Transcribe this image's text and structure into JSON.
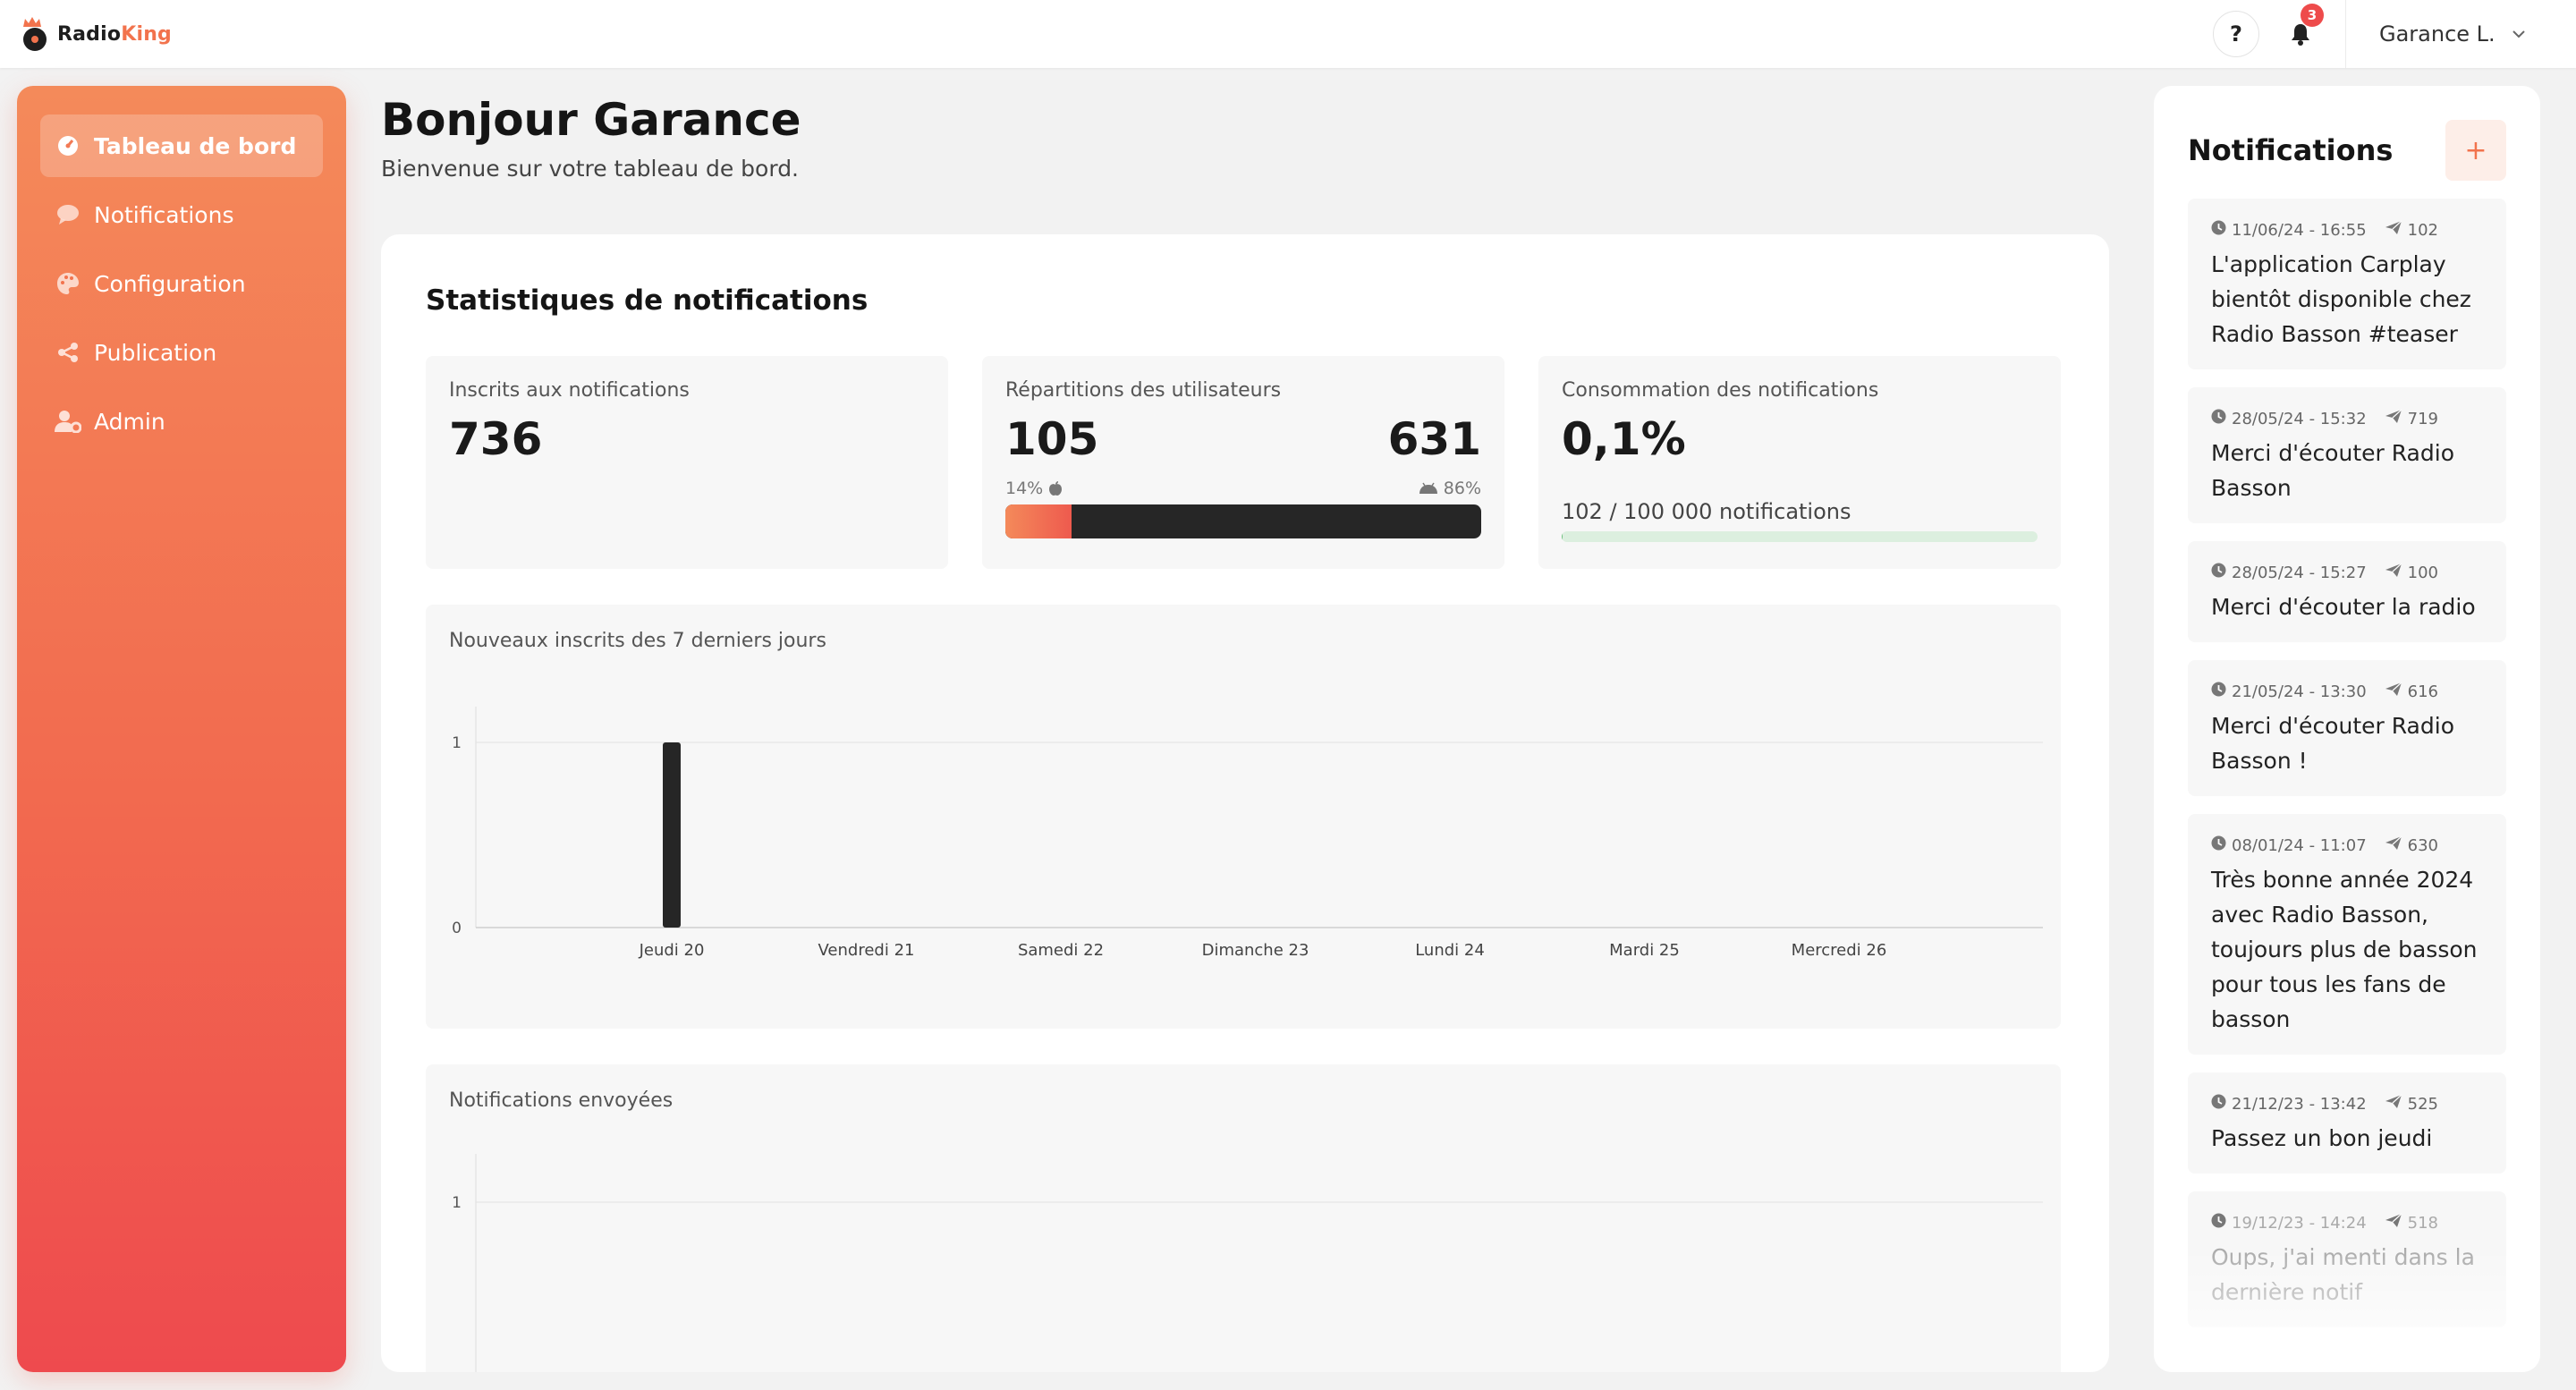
{
  "brand": {
    "name_part1": "Radio",
    "name_part2": "King",
    "accent": "#f2734d"
  },
  "topbar": {
    "help_label": "?",
    "notification_count": "3",
    "user_name": "Garance L."
  },
  "sidebar": {
    "items": [
      {
        "label": "Tableau de bord",
        "icon": "dashboard-icon",
        "active": true
      },
      {
        "label": "Notifications",
        "icon": "chat-bubble-icon",
        "active": false
      },
      {
        "label": "Configuration",
        "icon": "palette-icon",
        "active": false
      },
      {
        "label": "Publication",
        "icon": "share-icon",
        "active": false
      },
      {
        "label": "Admin",
        "icon": "user-gear-icon",
        "active": false
      }
    ]
  },
  "greeting": {
    "title": "Bonjour Garance",
    "subtitle": "Bienvenue sur votre tableau de bord."
  },
  "stats": {
    "title": "Statistiques de notifications",
    "subscribers": {
      "label": "Inscrits aux notifications",
      "value": "736"
    },
    "split": {
      "label": "Répartitions des utilisateurs",
      "ios_value": "105",
      "android_value": "631",
      "ios_pct": "14%",
      "android_pct": "86%",
      "ios_share": 0.14
    },
    "usage": {
      "label": "Consommation des notifications",
      "value": "0,1%",
      "detail": "102 / 100 000 notifications",
      "share": 0.00102
    }
  },
  "chart_data": [
    {
      "type": "bar",
      "title": "Nouveaux inscrits des 7 derniers jours",
      "categories": [
        "Jeudi 20",
        "Vendredi 21",
        "Samedi 22",
        "Dimanche 23",
        "Lundi 24",
        "Mardi 25",
        "Mercredi 26"
      ],
      "values": [
        1,
        0,
        0,
        0,
        0,
        0,
        0
      ],
      "yticks": [
        "0",
        "1"
      ],
      "ylim": [
        0,
        1
      ],
      "color": "#262626"
    },
    {
      "type": "bar",
      "title": "Notifications envoyées",
      "yticks": [
        "1"
      ],
      "ylim": [
        0,
        1
      ]
    }
  ],
  "notifications": {
    "title": "Notifications",
    "add_label": "+",
    "items": [
      {
        "date": "11/06/24 - 16:55",
        "count": "102",
        "text": "L'application Carplay bientôt disponible chez Radio Basson #teaser"
      },
      {
        "date": "28/05/24 - 15:32",
        "count": "719",
        "text": "Merci d'écouter Radio Basson"
      },
      {
        "date": "28/05/24 - 15:27",
        "count": "100",
        "text": "Merci d'écouter la radio"
      },
      {
        "date": "21/05/24 - 13:30",
        "count": "616",
        "text": "Merci d'écouter Radio Basson !"
      },
      {
        "date": "08/01/24 - 11:07",
        "count": "630",
        "text": "Très bonne année 2024 avec Radio Basson, toujours plus de basson pour tous les fans de basson"
      },
      {
        "date": "21/12/23 - 13:42",
        "count": "525",
        "text": "Passez un bon jeudi"
      },
      {
        "date": "19/12/23 - 14:24",
        "count": "518",
        "text": "Oups, j'ai menti dans la dernière notif"
      }
    ]
  }
}
